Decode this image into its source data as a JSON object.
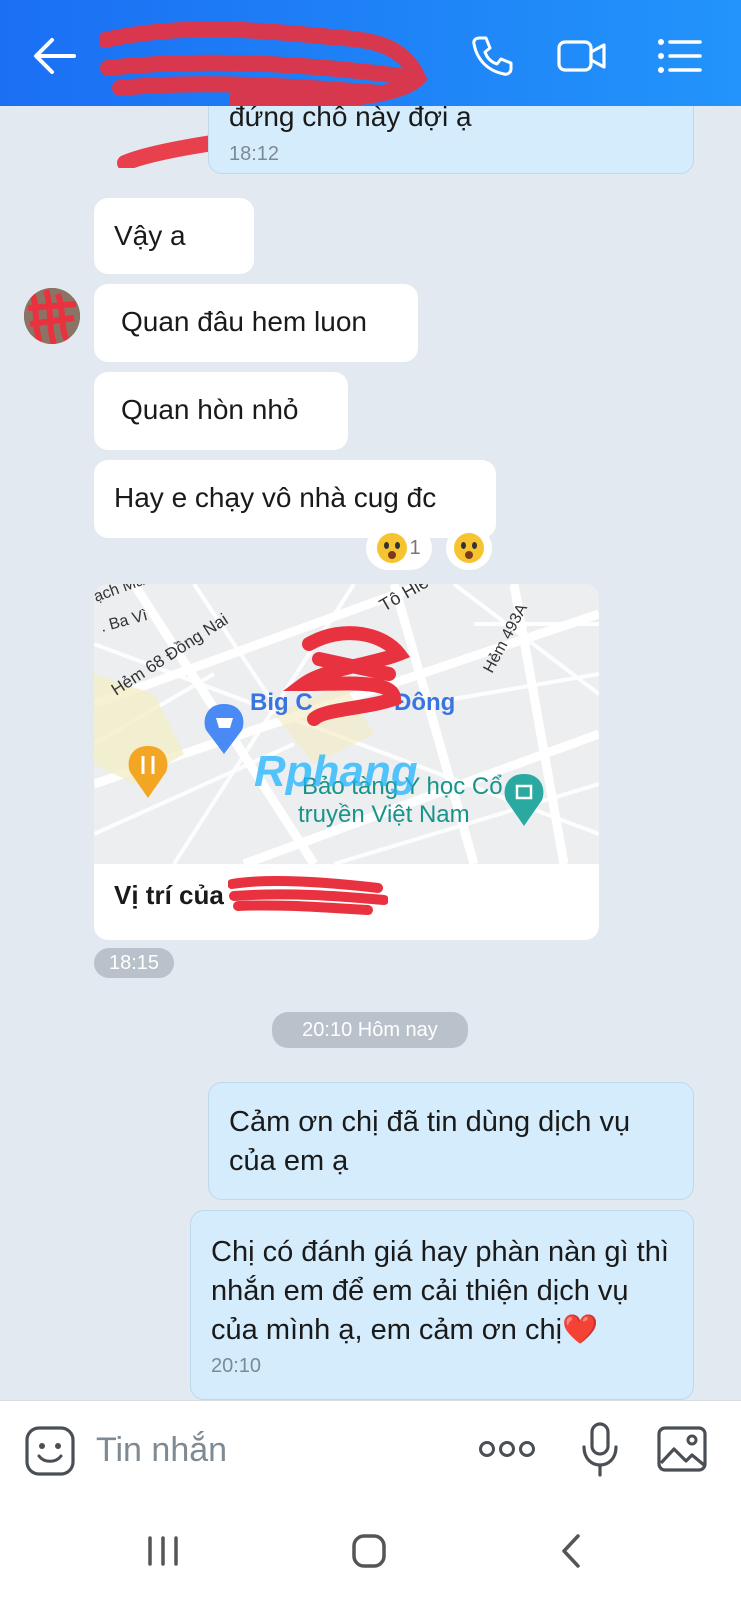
{
  "header": {
    "title": "",
    "actions": [
      "phone-icon",
      "video-call-icon",
      "menu-list-icon"
    ]
  },
  "messages": {
    "prev_out_text": "đứng chỗ này đợi ạ",
    "prev_out_time": "18:12",
    "incoming": [
      {
        "text": "Vậy a"
      },
      {
        "text": "Quan đâu hem luon"
      },
      {
        "text": "Quan hòn nhỏ"
      },
      {
        "text": "Hay e chạy vô nhà cug đc"
      }
    ],
    "reaction_count": "1",
    "map": {
      "labels": [
        "ạch Ma",
        ". Ba Vì",
        "Hẻm 68 Đồng Nai",
        "Tô Hiế",
        "Hẻm 493A",
        "Big C",
        "Đông",
        "Bảo tàng Y học Cổ",
        "truyền Việt Nam"
      ],
      "watermark": "Rphang",
      "caption": "Vị trí của"
    },
    "map_time": "18:15",
    "date_separator": "20:10 Hôm nay",
    "outgoing": [
      {
        "text": "Cảm ơn chị đã tin dùng dịch vụ của em ạ"
      },
      {
        "text": "Chị có đánh giá hay phàn nàn gì thì nhắn em để em cải thiện dịch vụ của mình ạ, em cảm ơn chị❤️",
        "time": "20:10"
      }
    ]
  },
  "input": {
    "placeholder": "Tin nhắn",
    "icons": [
      "sticker-icon",
      "more-icon",
      "microphone-icon",
      "image-icon"
    ]
  },
  "navbar": [
    "recents-icon",
    "home-icon",
    "back-nav-icon"
  ],
  "colors": {
    "header": "#1b6ff3",
    "outgoing_bubble": "#d4ecfc",
    "chat_bg": "#e2e9f1"
  }
}
